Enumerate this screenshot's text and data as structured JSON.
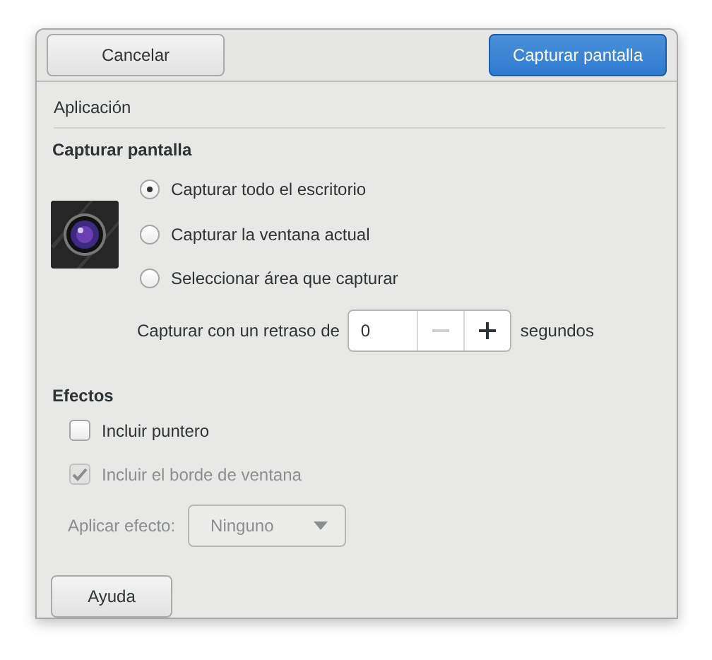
{
  "header": {
    "buttons": [
      {
        "label": "Cancelar",
        "kind": "default"
      },
      {
        "label": "Capturar pantalla",
        "kind": "primary"
      }
    ]
  },
  "application_label": "Aplicación",
  "capture": {
    "title": "Capturar pantalla",
    "options": [
      {
        "label": "Capturar todo el escritorio",
        "selected": true
      },
      {
        "label": "Capturar la ventana actual",
        "selected": false
      },
      {
        "label": "Seleccionar área que capturar",
        "selected": false
      }
    ],
    "delay": {
      "label": "Capturar con un retraso de",
      "value": "0",
      "unit": "segundos",
      "decrement_disabled": true
    }
  },
  "effects": {
    "title": "Efectos",
    "checkboxes": [
      {
        "label": "Incluir puntero",
        "checked": false,
        "disabled": false
      },
      {
        "label": "Incluir el borde de ventana",
        "checked": true,
        "disabled": true
      }
    ],
    "apply_effect": {
      "label": "Aplicar efecto:",
      "value": "Ninguno",
      "disabled": true
    }
  },
  "footer_button": "Ayuda"
}
